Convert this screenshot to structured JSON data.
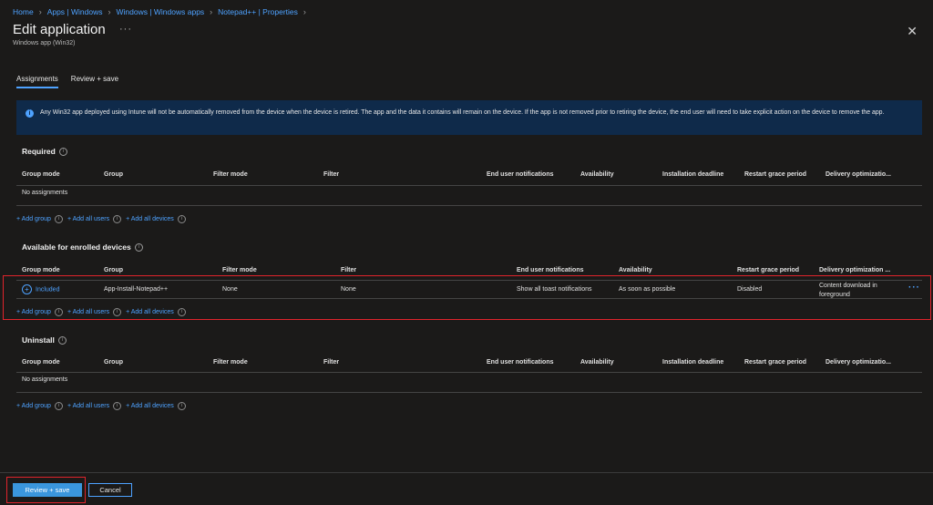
{
  "breadcrumb": [
    "Home",
    "Apps | Windows",
    "Windows | Windows apps",
    "Notepad++ | Properties"
  ],
  "header": {
    "title": "Edit application",
    "subtitle": "Windows app (Win32)",
    "more_label": "···",
    "close_label": "✕"
  },
  "tabs": [
    {
      "label": "Assignments",
      "active": true
    },
    {
      "label": "Review + save",
      "active": false
    }
  ],
  "banner": {
    "icon": "info-icon",
    "text": "Any Win32 app deployed using Intune will not be automatically removed from the device when the device is retired. The app and the data it contains will remain on the device. If the app is not removed prior to retiring the device, the end user will need to take explicit action on the device to remove the app."
  },
  "sections": {
    "required": {
      "title": "Required",
      "columns": [
        "Group mode",
        "Group",
        "Filter mode",
        "Filter",
        "End user notifications",
        "Availability",
        "Installation deadline",
        "Restart grace period",
        "Delivery optimizatio..."
      ],
      "empty": "No assignments"
    },
    "available": {
      "title": "Available for enrolled devices",
      "columns": [
        "Group mode",
        "Group",
        "Filter mode",
        "Filter",
        "End user notifications",
        "Availability",
        "Restart grace period",
        "Delivery optimization ..."
      ],
      "row": {
        "group_mode": "Included",
        "group": "App-Install-Notepad++",
        "filter_mode": "None",
        "filter": "None",
        "notifications": "Show all toast notifications",
        "availability": "As soon as possible",
        "restart": "Disabled",
        "delivery_line1": "Content download in",
        "delivery_line2": "foreground",
        "more": "···"
      }
    },
    "uninstall": {
      "title": "Uninstall",
      "columns": [
        "Group mode",
        "Group",
        "Filter mode",
        "Filter",
        "End user notifications",
        "Availability",
        "Installation deadline",
        "Restart grace period",
        "Delivery optimizatio..."
      ],
      "empty": "No assignments"
    }
  },
  "add_links": {
    "add_group": "+ Add group",
    "add_all_users": "+ Add all users",
    "add_all_devices": "+ Add all devices",
    "info": "i"
  },
  "footer": {
    "review_save": "Review + save",
    "cancel": "Cancel"
  },
  "colors": {
    "background": "#1b1a19",
    "accent": "#4ea2ff",
    "banner": "#0f2a4a",
    "highlight": "#e0242c"
  }
}
